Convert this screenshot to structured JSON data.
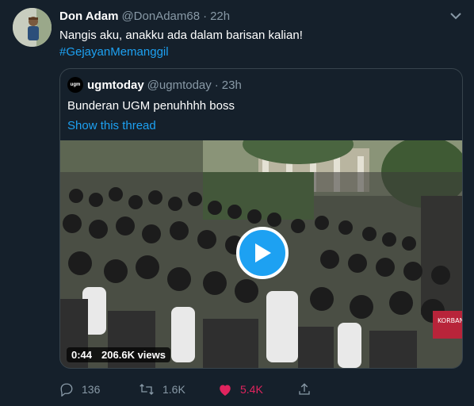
{
  "tweet": {
    "name": "Don Adam",
    "handle": "@DonAdam68",
    "separator": "·",
    "time": "22h",
    "text": "Nangis aku, anakku ada dalam barisan kalian!",
    "hashtag": "#GejayanMemanggil"
  },
  "quoted": {
    "avatar_text": "ugm",
    "name": "ugmtoday",
    "handle": "@ugmtoday",
    "separator": "·",
    "time": "23h",
    "text": "Bunderan UGM penuhhhh boss",
    "thread_link": "Show this thread",
    "video": {
      "duration": "0:44",
      "views": "206.6K views",
      "sign_text": "KORBAN AMBY"
    }
  },
  "actions": {
    "replies": "136",
    "retweets": "1.6K",
    "likes": "5.4K",
    "liked": true
  },
  "colors": {
    "background": "#15202b",
    "accent": "#1da1f2",
    "muted": "#8899a6",
    "like": "#e0245e"
  },
  "icons": [
    "reply-icon",
    "retweet-icon",
    "heart-icon",
    "share-icon",
    "chevron-down-icon",
    "play-icon"
  ]
}
